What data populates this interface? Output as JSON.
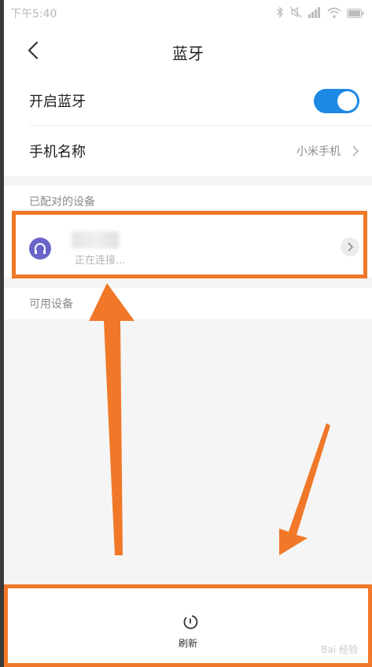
{
  "status_bar": {
    "time": "下午5:40"
  },
  "header": {
    "title": "蓝牙",
    "back_icon": "chevron-left-icon"
  },
  "settings": {
    "bluetooth_label": "开启蓝牙",
    "bluetooth_enabled": true,
    "device_name_label": "手机名称",
    "device_name_value": "小米手机"
  },
  "paired": {
    "header": "已配对的设备",
    "device": {
      "icon": "headphones-icon",
      "status": "正在连接..."
    }
  },
  "available": {
    "header": "可用设备"
  },
  "bottom_bar": {
    "refresh_label": "刷新",
    "refresh_icon": "refresh-icon"
  },
  "watermark": "Bai 经验",
  "colors": {
    "accent": "#1e88e5",
    "annotation": "#f07828",
    "avatar": "#6a64c9"
  }
}
